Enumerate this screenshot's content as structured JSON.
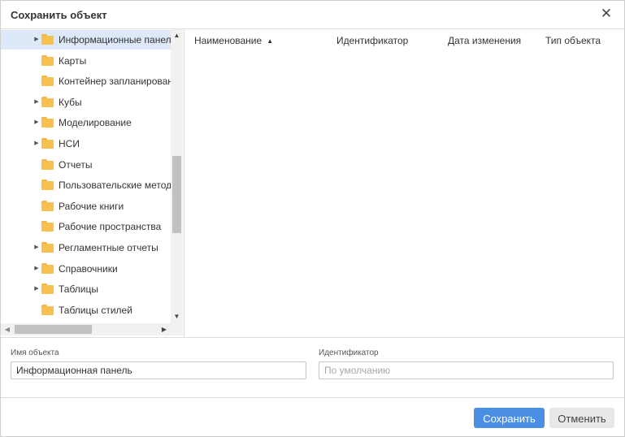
{
  "dialog": {
    "title": "Сохранить объект",
    "close_icon": "close-icon"
  },
  "tree": {
    "items": [
      {
        "label": "Информационные панели",
        "expandable": true,
        "selected": true
      },
      {
        "label": "Карты",
        "expandable": false,
        "selected": false
      },
      {
        "label": "Контейнер запланированн",
        "expandable": false,
        "selected": false
      },
      {
        "label": "Кубы",
        "expandable": true,
        "selected": false
      },
      {
        "label": "Моделирование",
        "expandable": true,
        "selected": false
      },
      {
        "label": "НСИ",
        "expandable": true,
        "selected": false
      },
      {
        "label": "Отчеты",
        "expandable": false,
        "selected": false
      },
      {
        "label": "Пользовательские методы",
        "expandable": false,
        "selected": false
      },
      {
        "label": "Рабочие книги",
        "expandable": false,
        "selected": false
      },
      {
        "label": "Рабочие пространства",
        "expandable": false,
        "selected": false
      },
      {
        "label": "Регламентные отчеты",
        "expandable": true,
        "selected": false
      },
      {
        "label": "Справочники",
        "expandable": true,
        "selected": false
      },
      {
        "label": "Таблицы",
        "expandable": true,
        "selected": false
      },
      {
        "label": "Таблицы стилей",
        "expandable": false,
        "selected": false
      }
    ]
  },
  "table": {
    "columns": [
      "Наименование",
      "Идентификатор",
      "Дата изменения",
      "Тип объекта"
    ],
    "sorted_column": "Наименование",
    "sort_direction": "ascending"
  },
  "form": {
    "name_label": "Имя объекта",
    "name_value": "Информационная панель",
    "id_label": "Идентификатор",
    "id_placeholder": "По умолчанию"
  },
  "buttons": {
    "save_label": "Сохранить",
    "cancel_label": "Отменить"
  },
  "colors": {
    "accent": "#4a8fe4",
    "selection": "#dde8f8",
    "folder": "#f8c04e"
  }
}
